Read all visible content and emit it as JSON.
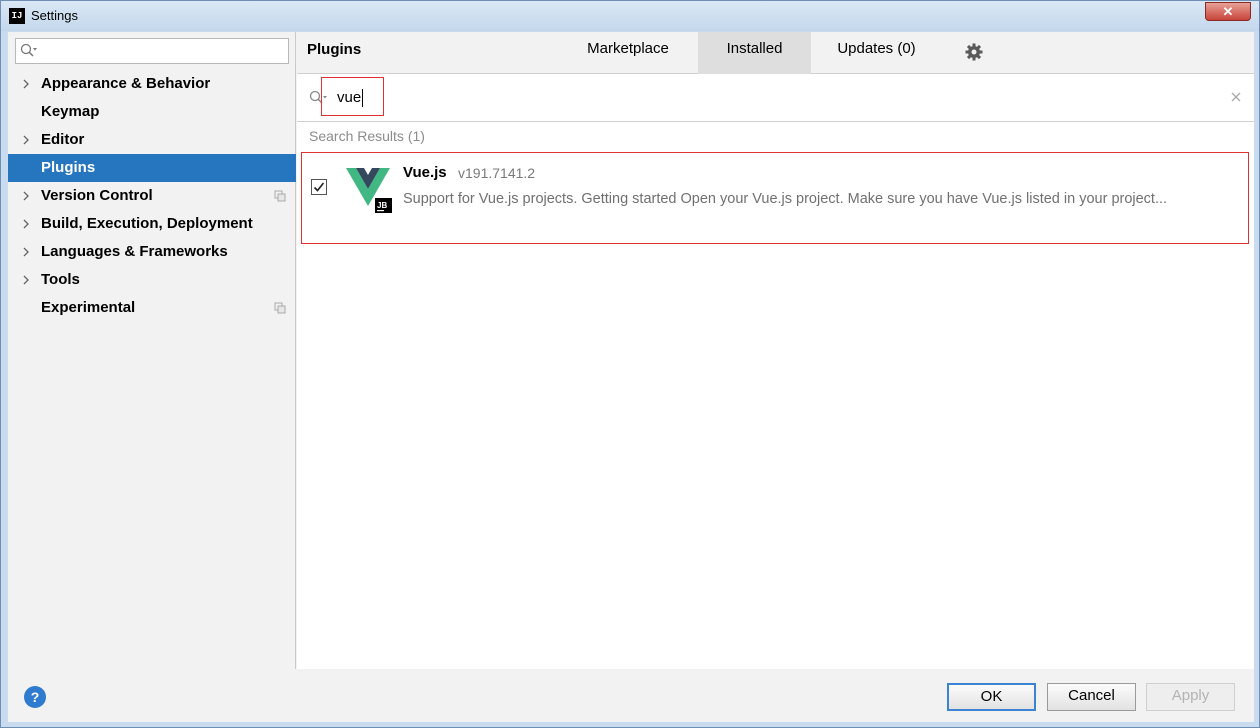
{
  "window": {
    "title": "Settings",
    "app_icon_text": "IJ"
  },
  "sidebar": {
    "search_value": "",
    "items": [
      {
        "label": "Appearance & Behavior",
        "expandable": true,
        "copy": false,
        "selected": false
      },
      {
        "label": "Keymap",
        "expandable": false,
        "copy": false,
        "selected": false
      },
      {
        "label": "Editor",
        "expandable": true,
        "copy": false,
        "selected": false
      },
      {
        "label": "Plugins",
        "expandable": false,
        "copy": false,
        "selected": true
      },
      {
        "label": "Version Control",
        "expandable": true,
        "copy": true,
        "selected": false
      },
      {
        "label": "Build, Execution, Deployment",
        "expandable": true,
        "copy": false,
        "selected": false
      },
      {
        "label": "Languages & Frameworks",
        "expandable": true,
        "copy": false,
        "selected": false
      },
      {
        "label": "Tools",
        "expandable": true,
        "copy": false,
        "selected": false
      },
      {
        "label": "Experimental",
        "expandable": false,
        "copy": true,
        "selected": false
      }
    ]
  },
  "plugins": {
    "title": "Plugins",
    "tabs": {
      "marketplace": "Marketplace",
      "installed": "Installed",
      "updates": "Updates (0)"
    },
    "active_tab": "installed",
    "search": {
      "value": "vue"
    },
    "results_label": "Search Results (1)",
    "results": [
      {
        "name": "Vue.js",
        "version": "v191.7141.2",
        "description": "Support for Vue.js projects. Getting started Open your Vue.js project. Make sure you have Vue.js listed in your project...",
        "enabled": true,
        "badge": "JB"
      }
    ]
  },
  "footer": {
    "ok": "OK",
    "cancel": "Cancel",
    "apply": "Apply",
    "help": "?"
  },
  "colors": {
    "selection": "#2675bf",
    "highlight_box": "#e03030",
    "vue_green": "#41b883",
    "vue_dark": "#35495e"
  }
}
